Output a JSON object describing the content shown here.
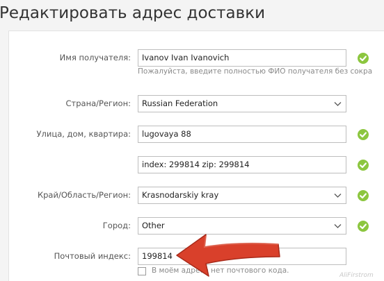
{
  "page": {
    "title": "Редактировать адрес доставки"
  },
  "form": {
    "recipient": {
      "label": "Имя получателя:",
      "value": "Ivanov Ivan Ivanovich",
      "hint": "Пожалуйста, введите полностью ФИО получателя без сокра"
    },
    "country": {
      "label": "Страна/Регион:",
      "value": "Russian Federation"
    },
    "street": {
      "label": "Улица, дом, квартира:",
      "value": "lugovaya 88"
    },
    "street2": {
      "value": "index: 299814 zip: 299814"
    },
    "region": {
      "label": "Край/Область/Регион:",
      "value": "Krasnodarskiy kray"
    },
    "city": {
      "label": "Город:",
      "value": "Other"
    },
    "zip": {
      "label": "Почтовый индекс:",
      "value": "199814"
    },
    "no_zip": {
      "label": "В моём адресе нет почтового кода.",
      "checked": false
    }
  },
  "icons": {
    "valid": "check-circle-icon",
    "dropdown": "chevron-down-icon",
    "annotation": "red-arrow"
  },
  "colors": {
    "valid_green": "#8cc63f",
    "arrow_red": "#d9402b"
  },
  "watermark": "AliFirstrom"
}
